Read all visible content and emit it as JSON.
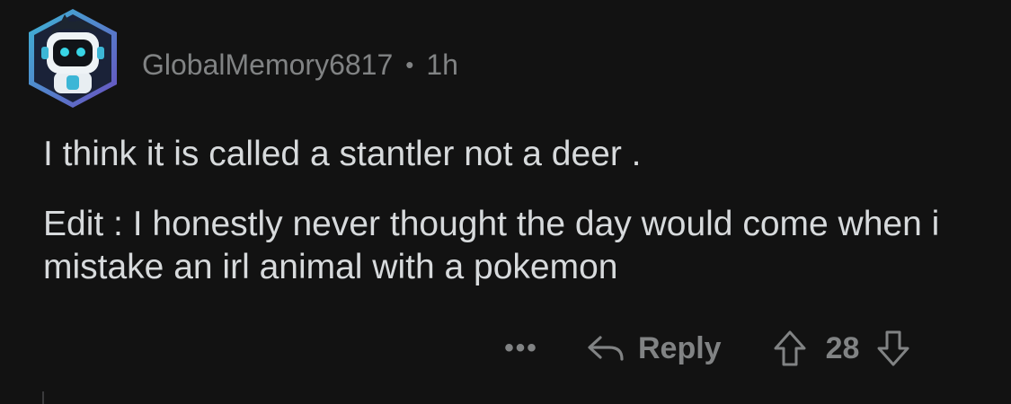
{
  "comment": {
    "username": "GlobalMemory6817",
    "separator": "•",
    "time": "1h",
    "paragraphs": [
      "I think it is called a stantler not a deer .",
      "Edit : I honestly never thought the day would come when i mistake an irl animal with a pokemon"
    ],
    "avatar_icon": "robot-avatar-icon"
  },
  "actions": {
    "more_label": "•••",
    "reply_label": "Reply",
    "score": "28",
    "reply_icon": "reply-arrow-icon",
    "upvote_icon": "upvote-arrow-icon",
    "downvote_icon": "downvote-arrow-icon"
  },
  "colors": {
    "background": "#121212",
    "text": "#d7dadc",
    "muted": "#818384",
    "avatar_blue": "#2fa9c8",
    "avatar_purple": "#7b5cc7"
  }
}
